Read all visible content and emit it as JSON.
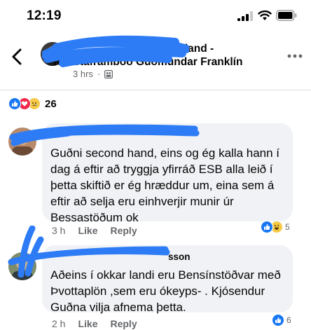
{
  "status_bar": {
    "time": "12:19",
    "icons": [
      "cellular-signal-icon",
      "wifi-icon",
      "battery-icon"
    ]
  },
  "header": {
    "group_name": "Betra Ísland -",
    "post_title": "forsetaframboð Guðmundar Franklín",
    "time": "3 hrs",
    "separator": "·",
    "icons": [
      "back-arrow-icon",
      "group-privacy-icon",
      "more-options-icon"
    ]
  },
  "reactions_summary": {
    "types": [
      "like",
      "love",
      "sad"
    ],
    "count": "26"
  },
  "comments": [
    {
      "author": "",
      "text": "Guðni second hand, eins og ég kalla hann í dag á eftir að tryggja yfirráð ESB alla leið í þetta skiftið er ég hræddur um, eina sem á eftir að selja eru einhverjir munir úr Bessastöðum ok",
      "time": "3 h",
      "like_label": "Like",
      "reply_label": "Reply",
      "reactions": [
        "like",
        "haha"
      ],
      "reaction_count": "5"
    },
    {
      "author": "sson",
      "text": "Aðeins í okkar landi eru Bensínstöðvar með Þvottaplön ,sem eru ókeyps- . Kjósendur Guðna vilja afnema þetta.",
      "time": "2 h",
      "like_label": "Like",
      "reply_label": "Reply",
      "reactions": [
        "like"
      ],
      "reaction_count": "6"
    }
  ],
  "colors": {
    "facebook_blue": "#1877f2",
    "love_red": "#f0284a",
    "sad_yellow": "#f7c948",
    "bubble_gray": "#f0f2f5",
    "secondary_text": "#65676b",
    "redaction_blue": "#2d7cf6"
  }
}
